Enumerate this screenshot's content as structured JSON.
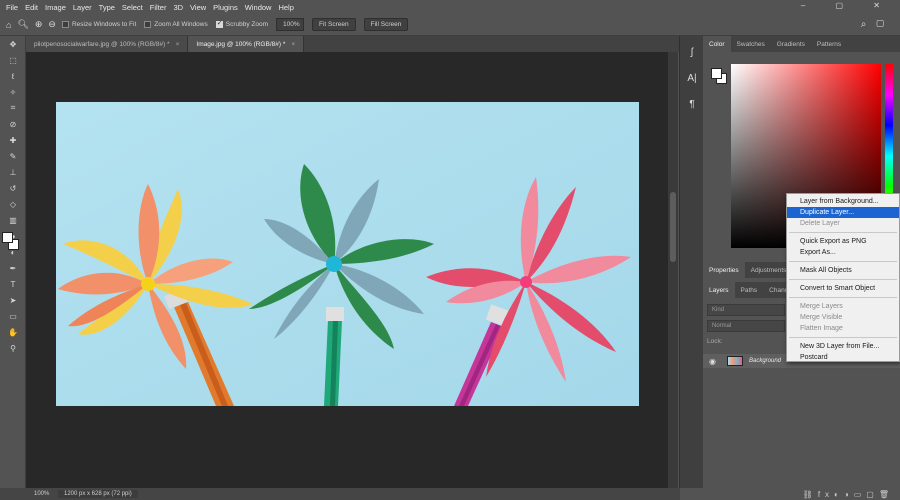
{
  "menubar": {
    "items": [
      "File",
      "Edit",
      "Image",
      "Layer",
      "Type",
      "Select",
      "Filter",
      "3D",
      "View",
      "Plugins",
      "Window",
      "Help"
    ],
    "window_controls": "– ▢ ✕"
  },
  "optionsbar": {
    "resize_windows_label": "Resize Windows to Fit",
    "resize_windows_checked": false,
    "zoom_all_label": "Zoom All Windows",
    "zoom_all_checked": false,
    "scrubby_zoom_label": "Scrubby Zoom",
    "scrubby_zoom_checked": true,
    "zoom_value": "100%",
    "fit_screen_label": "Fit Screen",
    "fill_screen_label": "Fill Screen"
  },
  "tabs": [
    {
      "label": "pilotpenosocialwarfare.jpg @ 100% (RGB/8#) *",
      "close": "×",
      "active": false
    },
    {
      "label": "Image.jpg @ 100% (RGB/8#) *",
      "close": "×",
      "active": true
    }
  ],
  "statusbar": {
    "zoom": "100%",
    "dimensions": "1200 px x 628 px (72 ppi)"
  },
  "color_panel": {
    "tabs": [
      "Color",
      "Swatches",
      "Gradients",
      "Patterns"
    ],
    "active_tab": "Color",
    "hue_color": "#ff0000"
  },
  "properties_panel": {
    "tabs": [
      "Properties",
      "Adjustments"
    ]
  },
  "layers_panel": {
    "tabs": [
      "Layers",
      "Paths",
      "Channe"
    ],
    "search_placeholder": "Kind",
    "blend_mode": "Normal",
    "lock_label": "Lock:",
    "layer_name": "Background"
  },
  "context_menu": {
    "items": [
      {
        "label": "Layer from Background...",
        "state": "normal"
      },
      {
        "label": "Duplicate Layer...",
        "state": "highlighted"
      },
      {
        "label": "Delete Layer",
        "state": "disabled"
      },
      {
        "sep": true
      },
      {
        "label": "Quick Export as PNG",
        "state": "normal"
      },
      {
        "label": "Export As...",
        "state": "normal"
      },
      {
        "sep": true
      },
      {
        "label": "Mask All Objects",
        "state": "normal"
      },
      {
        "sep": true
      },
      {
        "label": "Convert to Smart Object",
        "state": "normal"
      },
      {
        "sep": true
      },
      {
        "label": "Merge Layers",
        "state": "disabled"
      },
      {
        "label": "Merge Visible",
        "state": "disabled"
      },
      {
        "label": "Flatten Image",
        "state": "disabled"
      },
      {
        "sep": true
      },
      {
        "label": "New 3D Layer from File...",
        "state": "normal"
      },
      {
        "label": "Postcard",
        "state": "normal"
      }
    ]
  },
  "icons": {
    "tools": [
      "move-icon",
      "marquee-icon",
      "lasso-icon",
      "magic-wand-icon",
      "crop-icon",
      "eyedropper-icon",
      "healing-icon",
      "brush-icon",
      "stamp-icon",
      "history-brush-icon",
      "eraser-icon",
      "gradient-icon",
      "blur-icon",
      "dodge-icon",
      "pen-icon",
      "type-icon",
      "path-select-icon",
      "shape-icon",
      "hand-icon",
      "zoom-icon"
    ],
    "strip": [
      "glyphs-icon",
      "character-icon",
      "paragraph-icon"
    ]
  }
}
